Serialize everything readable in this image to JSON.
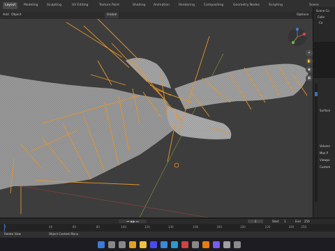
{
  "workspace_tabs": [
    "Layout",
    "Modeling",
    "Sculpting",
    "UV Editing",
    "Texture Paint",
    "Shading",
    "Animation",
    "Rendering",
    "Compositing",
    "Geometry Nodes",
    "Scripting"
  ],
  "active_tab": "Layout",
  "scene_label": "Scene",
  "header": {
    "mode_add": "Add",
    "mode_object": "Object",
    "transform": "Global",
    "options": "Options"
  },
  "outliner": {
    "items": [
      "Scene Co",
      "Colle",
      "Ca"
    ]
  },
  "properties": {
    "items": [
      "Surface",
      "Volume",
      "Max P",
      "Viewpo",
      "Custom"
    ]
  },
  "timeline": {
    "ticks": [
      "0",
      "40",
      "60",
      "80",
      "100",
      "120",
      "140",
      "160",
      "180",
      "200",
      "220",
      "240",
      "250"
    ],
    "start_label": "Start",
    "start_value": "1",
    "end_label": "End",
    "end_value": "250",
    "current_frame": "1"
  },
  "statusbar": {
    "left": "Rotate View",
    "right": "Object Context Menu"
  },
  "taskbar": {
    "icons": [
      "start-icon",
      "search-icon",
      "taskview-icon",
      "chrome-icon",
      "explorer-icon",
      "store-icon",
      "mail-icon",
      "edge-icon",
      "app1-icon",
      "app2-icon",
      "blender-icon",
      "app3-icon",
      "app4-icon",
      "app5-icon"
    ]
  },
  "colors": {
    "accent": "#e08a1e",
    "bone": "#f0a030",
    "viewport": "#3d3d3d"
  }
}
